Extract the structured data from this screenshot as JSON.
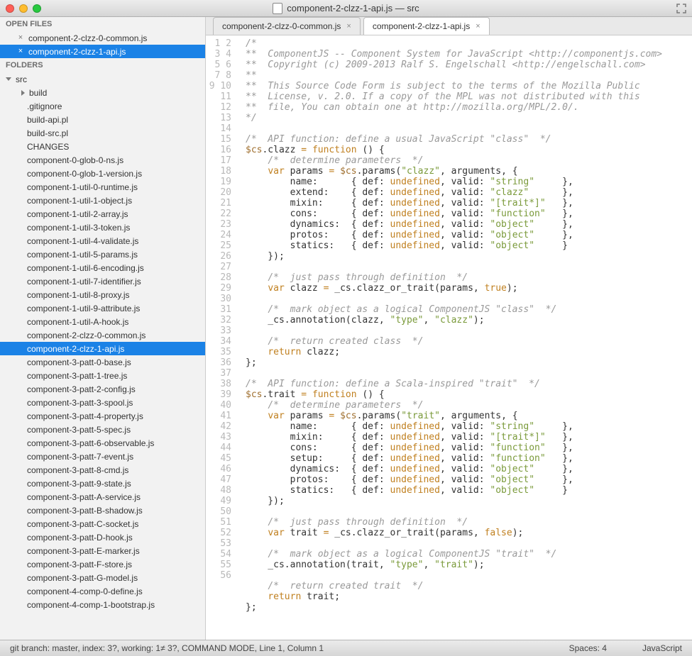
{
  "window": {
    "title": "component-2-clzz-1-api.js — src"
  },
  "sidebar": {
    "openFilesLabel": "OPEN FILES",
    "foldersLabel": "FOLDERS",
    "openFiles": [
      {
        "name": "component-2-clzz-0-common.js",
        "selected": false
      },
      {
        "name": "component-2-clzz-1-api.js",
        "selected": true
      }
    ],
    "root": "src",
    "subfolder": "build",
    "files": [
      ".gitignore",
      "build-api.pl",
      "build-src.pl",
      "CHANGES",
      "component-0-glob-0-ns.js",
      "component-0-glob-1-version.js",
      "component-1-util-0-runtime.js",
      "component-1-util-1-object.js",
      "component-1-util-2-array.js",
      "component-1-util-3-token.js",
      "component-1-util-4-validate.js",
      "component-1-util-5-params.js",
      "component-1-util-6-encoding.js",
      "component-1-util-7-identifier.js",
      "component-1-util-8-proxy.js",
      "component-1-util-9-attribute.js",
      "component-1-util-A-hook.js",
      "component-2-clzz-0-common.js",
      "component-2-clzz-1-api.js",
      "component-3-patt-0-base.js",
      "component-3-patt-1-tree.js",
      "component-3-patt-2-config.js",
      "component-3-patt-3-spool.js",
      "component-3-patt-4-property.js",
      "component-3-patt-5-spec.js",
      "component-3-patt-6-observable.js",
      "component-3-patt-7-event.js",
      "component-3-patt-8-cmd.js",
      "component-3-patt-9-state.js",
      "component-3-patt-A-service.js",
      "component-3-patt-B-shadow.js",
      "component-3-patt-C-socket.js",
      "component-3-patt-D-hook.js",
      "component-3-patt-E-marker.js",
      "component-3-patt-F-store.js",
      "component-3-patt-G-model.js",
      "component-4-comp-0-define.js",
      "component-4-comp-1-bootstrap.js"
    ],
    "selectedFile": "component-2-clzz-1-api.js"
  },
  "tabs": [
    {
      "label": "component-2-clzz-0-common.js",
      "active": false
    },
    {
      "label": "component-2-clzz-1-api.js",
      "active": true
    }
  ],
  "code": {
    "lineCount": 56,
    "lines": [
      {
        "t": "/*",
        "cls": "c-cm"
      },
      {
        "t": "**  ComponentJS -- Component System for JavaScript <http://componentjs.com>",
        "cls": "c-cm"
      },
      {
        "t": "**  Copyright (c) 2009-2013 Ralf S. Engelschall <http://engelschall.com>",
        "cls": "c-cm"
      },
      {
        "t": "**",
        "cls": "c-cm"
      },
      {
        "t": "**  This Source Code Form is subject to the terms of the Mozilla Public",
        "cls": "c-cm"
      },
      {
        "t": "**  License, v. 2.0. If a copy of the MPL was not distributed with this",
        "cls": "c-cm"
      },
      {
        "t": "**  file, You can obtain one at http://mozilla.org/MPL/2.0/.",
        "cls": "c-cm"
      },
      {
        "t": "*/",
        "cls": "c-cm"
      },
      {
        "t": "",
        "cls": ""
      },
      {
        "segs": [
          {
            "t": "/*  API function: define a usual JavaScript \"class\"  */",
            "cls": "c-cm"
          }
        ]
      },
      {
        "segs": [
          {
            "t": "$cs",
            "cls": "c-id"
          },
          {
            "t": ".clazz ",
            "cls": ""
          },
          {
            "t": "=",
            "cls": "c-kw"
          },
          {
            "t": " ",
            "cls": ""
          },
          {
            "t": "function",
            "cls": "c-kw"
          },
          {
            "t": " () {",
            "cls": ""
          }
        ]
      },
      {
        "segs": [
          {
            "t": "    ",
            "cls": ""
          },
          {
            "t": "/*  determine parameters  */",
            "cls": "c-cm"
          }
        ]
      },
      {
        "segs": [
          {
            "t": "    ",
            "cls": ""
          },
          {
            "t": "var",
            "cls": "c-kw"
          },
          {
            "t": " params ",
            "cls": ""
          },
          {
            "t": "=",
            "cls": "c-kw"
          },
          {
            "t": " ",
            "cls": ""
          },
          {
            "t": "$cs",
            "cls": "c-id"
          },
          {
            "t": ".params(",
            "cls": ""
          },
          {
            "t": "\"clazz\"",
            "cls": "c-s"
          },
          {
            "t": ", arguments, {",
            "cls": ""
          }
        ]
      },
      {
        "segs": [
          {
            "t": "        name:      { def: ",
            "cls": ""
          },
          {
            "t": "undefined",
            "cls": "c-kw"
          },
          {
            "t": ", valid: ",
            "cls": ""
          },
          {
            "t": "\"string\"",
            "cls": "c-s"
          },
          {
            "t": "     },",
            "cls": ""
          }
        ]
      },
      {
        "segs": [
          {
            "t": "        extend:    { def: ",
            "cls": ""
          },
          {
            "t": "undefined",
            "cls": "c-kw"
          },
          {
            "t": ", valid: ",
            "cls": ""
          },
          {
            "t": "\"clazz\"",
            "cls": "c-s"
          },
          {
            "t": "      },",
            "cls": ""
          }
        ]
      },
      {
        "segs": [
          {
            "t": "        mixin:     { def: ",
            "cls": ""
          },
          {
            "t": "undefined",
            "cls": "c-kw"
          },
          {
            "t": ", valid: ",
            "cls": ""
          },
          {
            "t": "\"[trait*]\"",
            "cls": "c-s"
          },
          {
            "t": "   },",
            "cls": ""
          }
        ]
      },
      {
        "segs": [
          {
            "t": "        cons:      { def: ",
            "cls": ""
          },
          {
            "t": "undefined",
            "cls": "c-kw"
          },
          {
            "t": ", valid: ",
            "cls": ""
          },
          {
            "t": "\"function\"",
            "cls": "c-s"
          },
          {
            "t": "   },",
            "cls": ""
          }
        ]
      },
      {
        "segs": [
          {
            "t": "        dynamics:  { def: ",
            "cls": ""
          },
          {
            "t": "undefined",
            "cls": "c-kw"
          },
          {
            "t": ", valid: ",
            "cls": ""
          },
          {
            "t": "\"object\"",
            "cls": "c-s"
          },
          {
            "t": "     },",
            "cls": ""
          }
        ]
      },
      {
        "segs": [
          {
            "t": "        protos:    { def: ",
            "cls": ""
          },
          {
            "t": "undefined",
            "cls": "c-kw"
          },
          {
            "t": ", valid: ",
            "cls": ""
          },
          {
            "t": "\"object\"",
            "cls": "c-s"
          },
          {
            "t": "     },",
            "cls": ""
          }
        ]
      },
      {
        "segs": [
          {
            "t": "        statics:   { def: ",
            "cls": ""
          },
          {
            "t": "undefined",
            "cls": "c-kw"
          },
          {
            "t": ", valid: ",
            "cls": ""
          },
          {
            "t": "\"object\"",
            "cls": "c-s"
          },
          {
            "t": "     }",
            "cls": ""
          }
        ]
      },
      {
        "segs": [
          {
            "t": "    });",
            "cls": ""
          }
        ]
      },
      {
        "t": "",
        "cls": ""
      },
      {
        "segs": [
          {
            "t": "    ",
            "cls": ""
          },
          {
            "t": "/*  just pass through definition  */",
            "cls": "c-cm"
          }
        ]
      },
      {
        "segs": [
          {
            "t": "    ",
            "cls": ""
          },
          {
            "t": "var",
            "cls": "c-kw"
          },
          {
            "t": " clazz ",
            "cls": ""
          },
          {
            "t": "=",
            "cls": "c-kw"
          },
          {
            "t": " _cs.clazz_or_trait(params, ",
            "cls": ""
          },
          {
            "t": "true",
            "cls": "c-kw"
          },
          {
            "t": ");",
            "cls": ""
          }
        ]
      },
      {
        "t": "",
        "cls": ""
      },
      {
        "segs": [
          {
            "t": "    ",
            "cls": ""
          },
          {
            "t": "/*  mark object as a logical ComponentJS \"class\"  */",
            "cls": "c-cm"
          }
        ]
      },
      {
        "segs": [
          {
            "t": "    _cs.annotation(clazz, ",
            "cls": ""
          },
          {
            "t": "\"type\"",
            "cls": "c-s"
          },
          {
            "t": ", ",
            "cls": ""
          },
          {
            "t": "\"clazz\"",
            "cls": "c-s"
          },
          {
            "t": ");",
            "cls": ""
          }
        ]
      },
      {
        "t": "",
        "cls": ""
      },
      {
        "segs": [
          {
            "t": "    ",
            "cls": ""
          },
          {
            "t": "/*  return created class  */",
            "cls": "c-cm"
          }
        ]
      },
      {
        "segs": [
          {
            "t": "    ",
            "cls": ""
          },
          {
            "t": "return",
            "cls": "c-kw"
          },
          {
            "t": " clazz;",
            "cls": ""
          }
        ]
      },
      {
        "segs": [
          {
            "t": "};",
            "cls": ""
          }
        ]
      },
      {
        "t": "",
        "cls": ""
      },
      {
        "segs": [
          {
            "t": "/*  API function: define a Scala-inspired \"trait\"  */",
            "cls": "c-cm"
          }
        ]
      },
      {
        "segs": [
          {
            "t": "$cs",
            "cls": "c-id"
          },
          {
            "t": ".trait ",
            "cls": ""
          },
          {
            "t": "=",
            "cls": "c-kw"
          },
          {
            "t": " ",
            "cls": ""
          },
          {
            "t": "function",
            "cls": "c-kw"
          },
          {
            "t": " () {",
            "cls": ""
          }
        ]
      },
      {
        "segs": [
          {
            "t": "    ",
            "cls": ""
          },
          {
            "t": "/*  determine parameters  */",
            "cls": "c-cm"
          }
        ]
      },
      {
        "segs": [
          {
            "t": "    ",
            "cls": ""
          },
          {
            "t": "var",
            "cls": "c-kw"
          },
          {
            "t": " params ",
            "cls": ""
          },
          {
            "t": "=",
            "cls": "c-kw"
          },
          {
            "t": " ",
            "cls": ""
          },
          {
            "t": "$cs",
            "cls": "c-id"
          },
          {
            "t": ".params(",
            "cls": ""
          },
          {
            "t": "\"trait\"",
            "cls": "c-s"
          },
          {
            "t": ", arguments, {",
            "cls": ""
          }
        ]
      },
      {
        "segs": [
          {
            "t": "        name:      { def: ",
            "cls": ""
          },
          {
            "t": "undefined",
            "cls": "c-kw"
          },
          {
            "t": ", valid: ",
            "cls": ""
          },
          {
            "t": "\"string\"",
            "cls": "c-s"
          },
          {
            "t": "     },",
            "cls": ""
          }
        ]
      },
      {
        "segs": [
          {
            "t": "        mixin:     { def: ",
            "cls": ""
          },
          {
            "t": "undefined",
            "cls": "c-kw"
          },
          {
            "t": ", valid: ",
            "cls": ""
          },
          {
            "t": "\"[trait*]\"",
            "cls": "c-s"
          },
          {
            "t": "   },",
            "cls": ""
          }
        ]
      },
      {
        "segs": [
          {
            "t": "        cons:      { def: ",
            "cls": ""
          },
          {
            "t": "undefined",
            "cls": "c-kw"
          },
          {
            "t": ", valid: ",
            "cls": ""
          },
          {
            "t": "\"function\"",
            "cls": "c-s"
          },
          {
            "t": "   },",
            "cls": ""
          }
        ]
      },
      {
        "segs": [
          {
            "t": "        setup:     { def: ",
            "cls": ""
          },
          {
            "t": "undefined",
            "cls": "c-kw"
          },
          {
            "t": ", valid: ",
            "cls": ""
          },
          {
            "t": "\"function\"",
            "cls": "c-s"
          },
          {
            "t": "   },",
            "cls": ""
          }
        ]
      },
      {
        "segs": [
          {
            "t": "        dynamics:  { def: ",
            "cls": ""
          },
          {
            "t": "undefined",
            "cls": "c-kw"
          },
          {
            "t": ", valid: ",
            "cls": ""
          },
          {
            "t": "\"object\"",
            "cls": "c-s"
          },
          {
            "t": "     },",
            "cls": ""
          }
        ]
      },
      {
        "segs": [
          {
            "t": "        protos:    { def: ",
            "cls": ""
          },
          {
            "t": "undefined",
            "cls": "c-kw"
          },
          {
            "t": ", valid: ",
            "cls": ""
          },
          {
            "t": "\"object\"",
            "cls": "c-s"
          },
          {
            "t": "     },",
            "cls": ""
          }
        ]
      },
      {
        "segs": [
          {
            "t": "        statics:   { def: ",
            "cls": ""
          },
          {
            "t": "undefined",
            "cls": "c-kw"
          },
          {
            "t": ", valid: ",
            "cls": ""
          },
          {
            "t": "\"object\"",
            "cls": "c-s"
          },
          {
            "t": "     }",
            "cls": ""
          }
        ]
      },
      {
        "segs": [
          {
            "t": "    });",
            "cls": ""
          }
        ]
      },
      {
        "t": "",
        "cls": ""
      },
      {
        "segs": [
          {
            "t": "    ",
            "cls": ""
          },
          {
            "t": "/*  just pass through definition  */",
            "cls": "c-cm"
          }
        ]
      },
      {
        "segs": [
          {
            "t": "    ",
            "cls": ""
          },
          {
            "t": "var",
            "cls": "c-kw"
          },
          {
            "t": " trait ",
            "cls": ""
          },
          {
            "t": "=",
            "cls": "c-kw"
          },
          {
            "t": " _cs.clazz_or_trait(params, ",
            "cls": ""
          },
          {
            "t": "false",
            "cls": "c-kw"
          },
          {
            "t": ");",
            "cls": ""
          }
        ]
      },
      {
        "t": "",
        "cls": ""
      },
      {
        "segs": [
          {
            "t": "    ",
            "cls": ""
          },
          {
            "t": "/*  mark object as a logical ComponentJS \"trait\"  */",
            "cls": "c-cm"
          }
        ]
      },
      {
        "segs": [
          {
            "t": "    _cs.annotation(trait, ",
            "cls": ""
          },
          {
            "t": "\"type\"",
            "cls": "c-s"
          },
          {
            "t": ", ",
            "cls": ""
          },
          {
            "t": "\"trait\"",
            "cls": "c-s"
          },
          {
            "t": ");",
            "cls": ""
          }
        ]
      },
      {
        "t": "",
        "cls": ""
      },
      {
        "segs": [
          {
            "t": "    ",
            "cls": ""
          },
          {
            "t": "/*  return created trait  */",
            "cls": "c-cm"
          }
        ]
      },
      {
        "segs": [
          {
            "t": "    ",
            "cls": ""
          },
          {
            "t": "return",
            "cls": "c-kw"
          },
          {
            "t": " trait;",
            "cls": ""
          }
        ]
      },
      {
        "segs": [
          {
            "t": "};",
            "cls": ""
          }
        ]
      },
      {
        "t": "",
        "cls": ""
      },
      {
        "t": "",
        "cls": ""
      }
    ]
  },
  "status": {
    "left": "git branch: master, index: 3?, working: 1≠ 3?, COMMAND MODE, Line 1, Column 1",
    "spaces": "Spaces: 4",
    "lang": "JavaScript"
  }
}
